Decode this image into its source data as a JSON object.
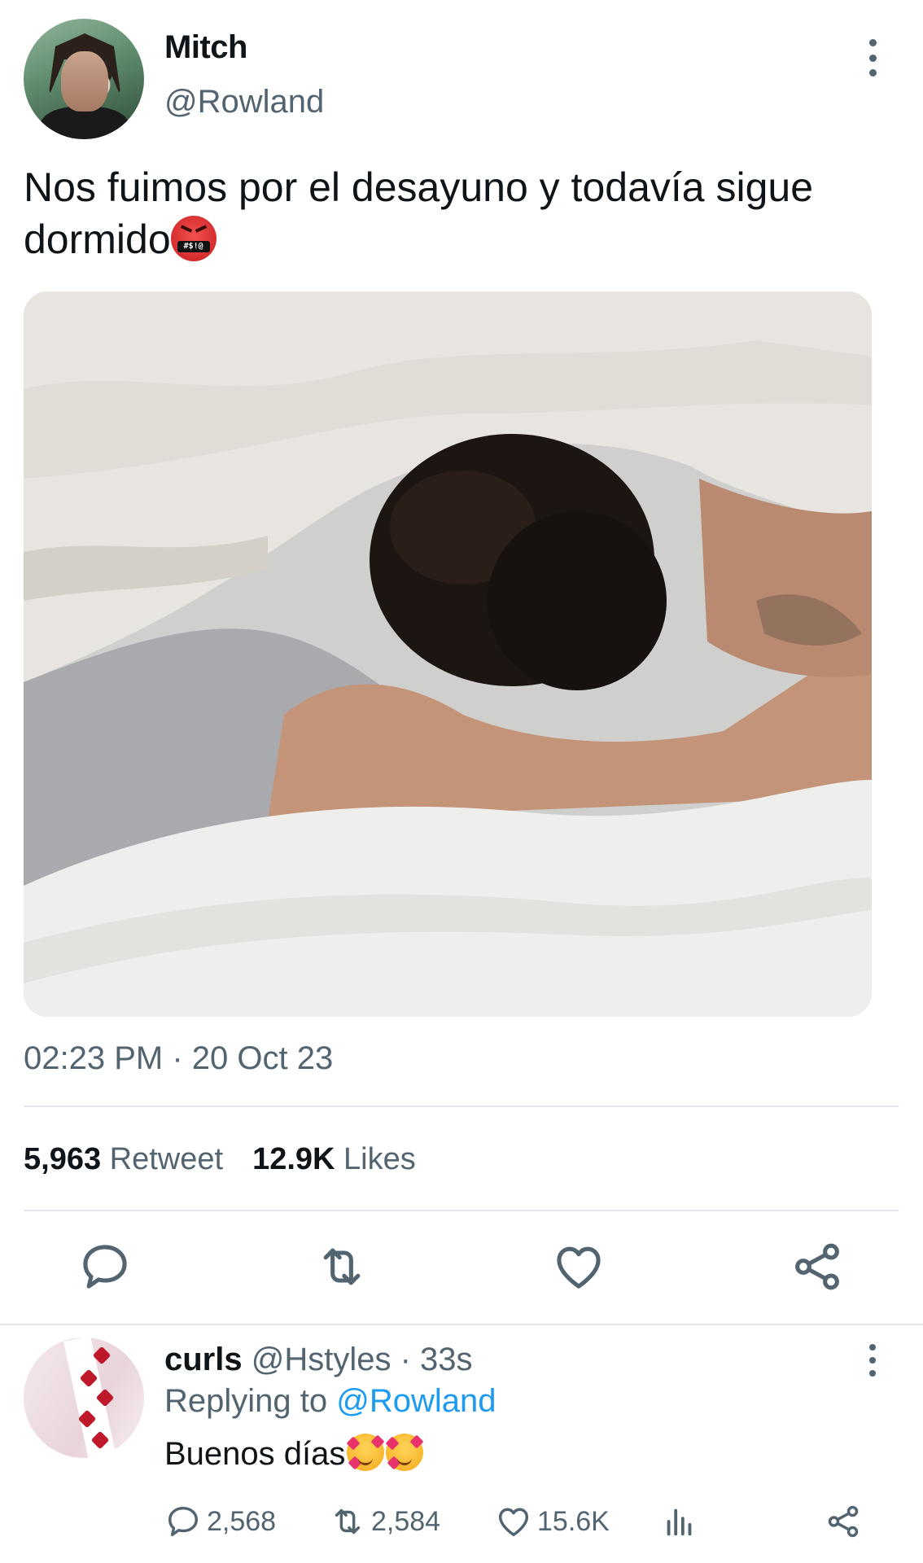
{
  "tweet": {
    "author_name": "Mitch",
    "author_handle": "@Rowland",
    "text": "Nos fuimos por el desayuno y todavía sigue dormido",
    "emoji_band_text": "#$!@",
    "timestamp": "02:23 PM · 20 Oct 23",
    "retweet_count": "5,963",
    "retweet_label": "Retweet",
    "likes_count": "12.9K",
    "likes_label": "Likes"
  },
  "actions": {
    "icons": [
      "reply-icon",
      "retweet-icon",
      "like-icon",
      "share-icon"
    ]
  },
  "reply": {
    "author_name": "curls",
    "author_handle": "@Hstyles",
    "separator": " · ",
    "age": "33s",
    "replying_prefix": "Replying to ",
    "replying_handle": "@Rowland",
    "text": "Buenos días",
    "reply_count": "2,568",
    "retweet_count": "2,584",
    "like_count": "15.6K"
  },
  "colors": {
    "text_primary": "#0f1419",
    "text_secondary": "#536471",
    "link": "#1d9bf0",
    "divider": "#e6e9ec"
  }
}
